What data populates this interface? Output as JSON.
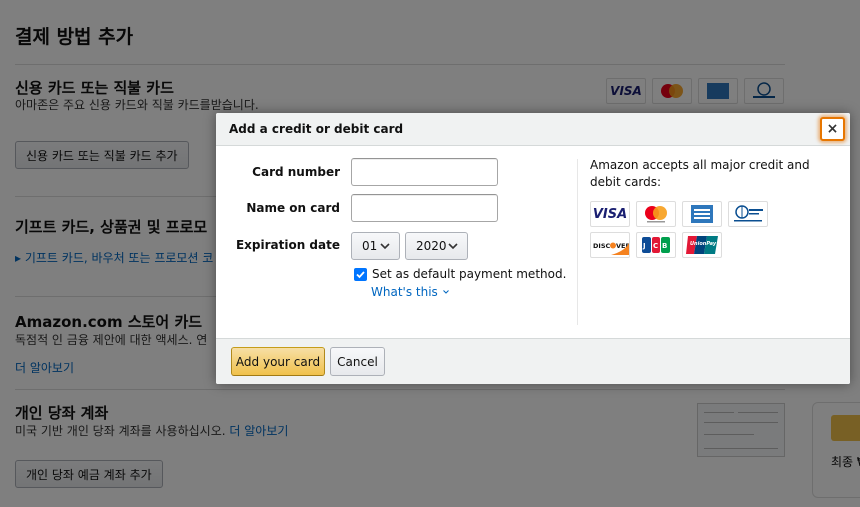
{
  "background": {
    "page_title": "결제 방법 추가",
    "credit": {
      "title": "신용 카드 또는 직불 카드",
      "desc": "아마존은 주요 신용 카드와 직불 카드를받습니다.",
      "button": "신용 카드 또는 직불 카드 추가"
    },
    "gift": {
      "title": "기프트 카드, 상품권 및 프로모",
      "link": "기프트 카드, 바우처 또는 프로모션 코"
    },
    "store_card": {
      "title": "Amazon.com 스토어 카드",
      "desc": "독점적 인 금융 제안에 대한 액세스. 연",
      "link": "더 알아보기"
    },
    "checking": {
      "title": "개인 당좌 계좌",
      "desc": "미국 기반 개인 당좌 계좌를 사용하십시오.",
      "link": "더 알아보기",
      "button": "개인 당좌 예금 계좌 추가"
    },
    "side_text": "최종 ₩",
    "small_logos": [
      "visa",
      "mastercard",
      "amex",
      "diners"
    ]
  },
  "modal": {
    "title": "Add a credit or debit card",
    "close_symbol": "×",
    "fields": {
      "card_number_label": "Card number",
      "card_number_value": "",
      "name_label": "Name on card",
      "name_value": "",
      "expiration_label": "Expiration date",
      "month": "01",
      "year": "2020"
    },
    "default_checkbox_label": "Set as default payment method.",
    "default_checked": true,
    "whats_this": "What's this",
    "accept_text": "Amazon accepts all major credit and debit cards:",
    "cards": [
      {
        "name": "visa-logo",
        "label": "VISA"
      },
      {
        "name": "mastercard-logo",
        "label": "mastercard"
      },
      {
        "name": "amex-logo",
        "label": "AMEX"
      },
      {
        "name": "diners-club-logo",
        "label": "Diners Club"
      },
      {
        "name": "discover-logo",
        "label": "DISCOVER"
      },
      {
        "name": "jcb-logo",
        "label": "JCB"
      },
      {
        "name": "unionpay-logo",
        "label": "UnionPay"
      }
    ],
    "primary_button": "Add your card",
    "cancel_button": "Cancel"
  },
  "colors": {
    "primary_button": "#f0c14b",
    "link": "#0066c0",
    "focus_ring": "#e77600"
  }
}
